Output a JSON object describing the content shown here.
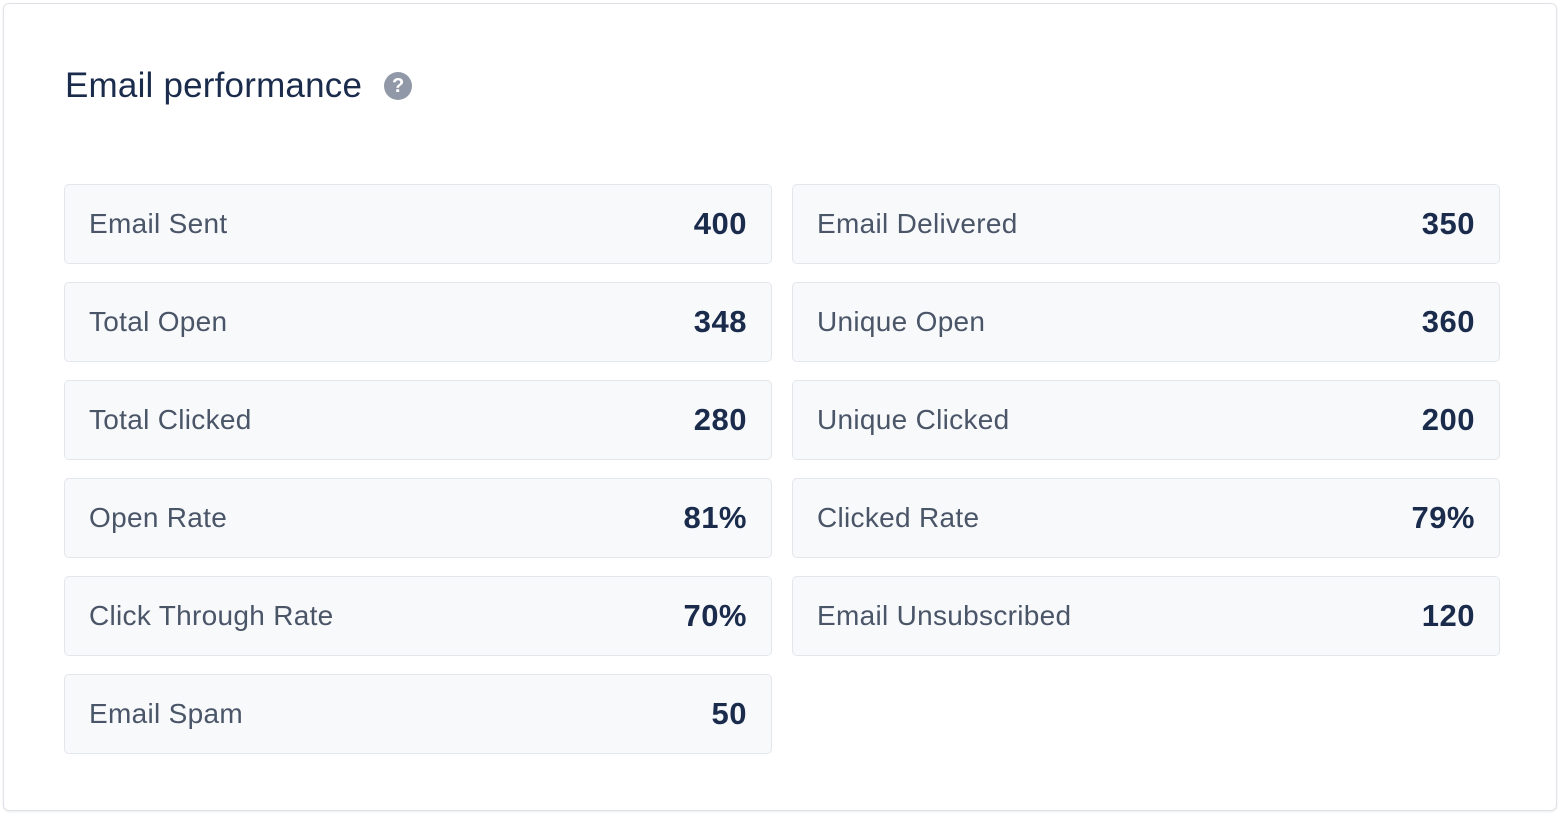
{
  "panel": {
    "title": "Email performance",
    "help_icon": "question-mark-icon",
    "help_glyph": "?"
  },
  "metrics": [
    {
      "label": "Email Sent",
      "value": "400"
    },
    {
      "label": "Email Delivered",
      "value": "350"
    },
    {
      "label": "Total Open",
      "value": "348"
    },
    {
      "label": "Unique Open",
      "value": "360"
    },
    {
      "label": "Total Clicked",
      "value": "280"
    },
    {
      "label": "Unique Clicked",
      "value": "200"
    },
    {
      "label": "Open Rate",
      "value": "81%"
    },
    {
      "label": "Clicked Rate",
      "value": "79%"
    },
    {
      "label": "Click Through Rate",
      "value": "70%"
    },
    {
      "label": "Email Unsubscribed",
      "value": "120"
    },
    {
      "label": "Email Spam",
      "value": "50"
    }
  ],
  "colors": {
    "title": "#1a2b4c",
    "label": "#4a5568",
    "value": "#1a2b4c",
    "tile_background": "#f8f9fb",
    "tile_border": "#e3e6eb",
    "help_icon": "#9199a8"
  }
}
